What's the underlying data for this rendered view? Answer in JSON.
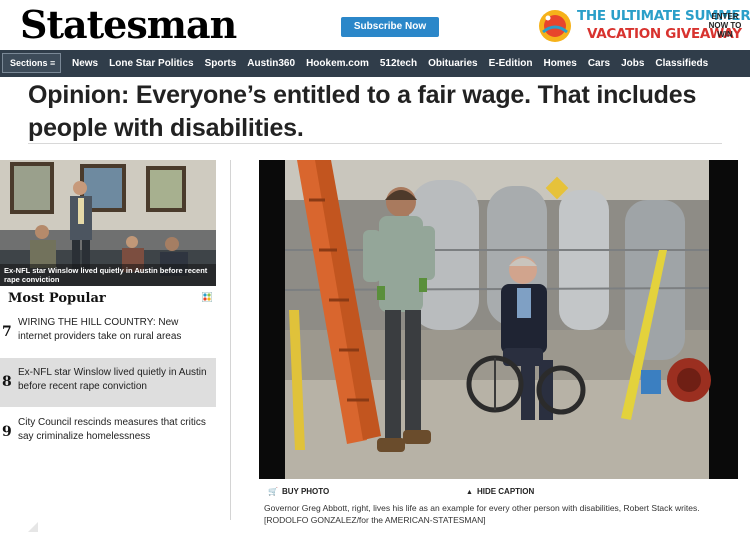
{
  "header": {
    "logo": "Statesman",
    "subscribe_label": "Subscribe Now",
    "ad": {
      "line1": "THE ULTIMATE SUMMER",
      "line2": "VACATION GIVEAWAY",
      "cta": "ENTER NOW TO WIN",
      "badge_text": "Summer"
    }
  },
  "nav": {
    "sections_label": "Sections ≡",
    "items": [
      "News",
      "Lone Star Politics",
      "Sports",
      "Austin360",
      "Hookem.com",
      "512tech",
      "Obituaries",
      "E-Edition",
      "Homes",
      "Cars",
      "Jobs",
      "Classifieds"
    ]
  },
  "article": {
    "headline": "Opinion: Everyone’s entitled to a fair wage. That includes people with disabilities."
  },
  "sidebar": {
    "teaser_caption": "Ex-NFL star Winslow lived quietly in Austin before recent rape conviction",
    "most_popular_heading": "Most Popular",
    "items": [
      {
        "num": "7",
        "text": "WIRING THE HILL COUNTRY: New internet providers take on rural areas"
      },
      {
        "num": "8",
        "text": "Ex-NFL star Winslow lived quietly in Austin before recent rape conviction"
      },
      {
        "num": "9",
        "text": "City Council rescinds measures that critics say criminalize homelessness"
      }
    ]
  },
  "photo": {
    "buy_label": "BUY PHOTO",
    "hide_caption_label": "HIDE CAPTION",
    "caption": "Governor Greg Abbott, right, lives his life as an example for every other person with disabilities, Robert Stack writes. [RODOLFO GONZALEZ/for the AMERICAN-STATESMAN]"
  },
  "colors": {
    "nav_bg": "#303d4a",
    "subscribe_bg": "#2b87c9",
    "ad_blue": "#2b9fc9",
    "ad_red": "#d8332f",
    "highlight_row": "#dedede"
  }
}
